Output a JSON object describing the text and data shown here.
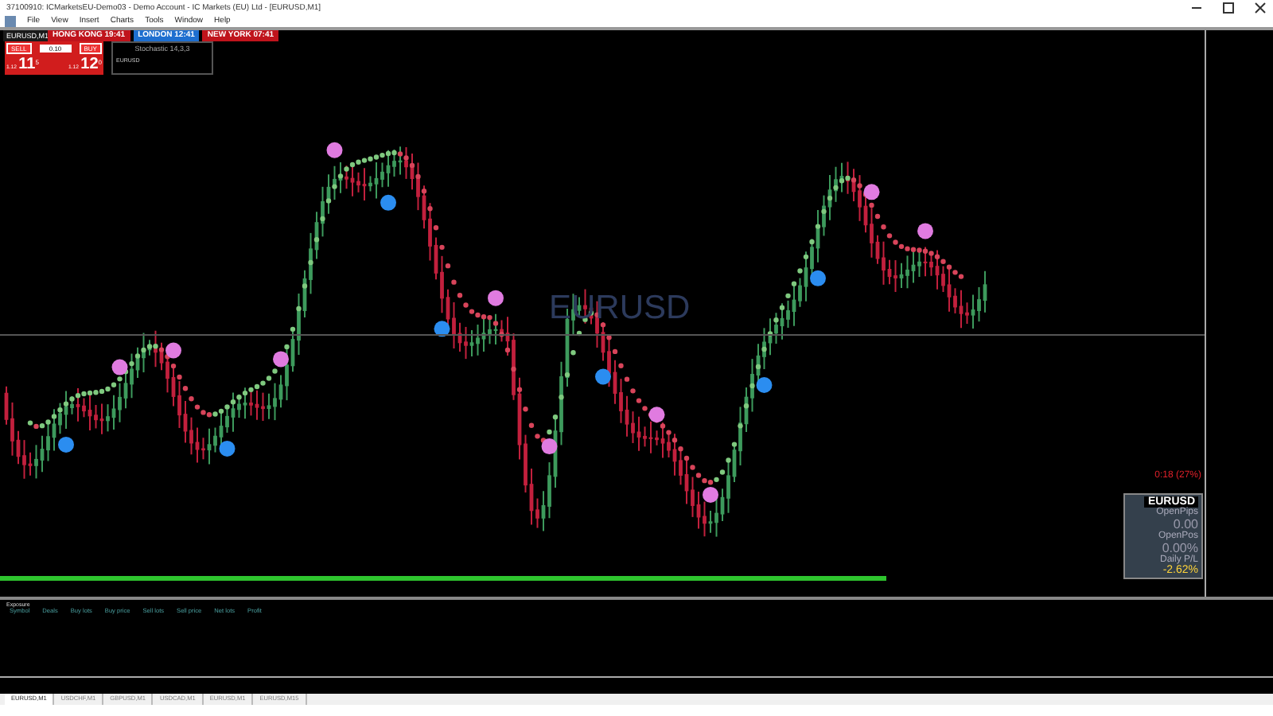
{
  "window": {
    "title": "37100910: ICMarketsEU-Demo03 - Demo Account - IC Markets (EU) Ltd - [EURUSD,M1]"
  },
  "menu": [
    "File",
    "View",
    "Insert",
    "Charts",
    "Tools",
    "Window",
    "Help"
  ],
  "chart_window": {
    "symbol": "EURUSD,M1"
  },
  "clocks": [
    {
      "city": "HONG KONG",
      "time": "19:41",
      "color": "#c0141c"
    },
    {
      "city": "LONDON",
      "time": "12:41",
      "color": "#1e6fd0"
    },
    {
      "city": "NEW YORK",
      "time": "07:41",
      "color": "#c0141c"
    }
  ],
  "trade_panel": {
    "sell_label": "SELL",
    "buy_label": "BUY",
    "lots": "0.10",
    "sell": {
      "prefix": "1.12",
      "big": "11",
      "sup": "5"
    },
    "buy": {
      "prefix": "1.12",
      "big": "12",
      "sup": "0"
    }
  },
  "stochastic": {
    "title": "Stochastic 14,3,3",
    "symbol": "EURUSD"
  },
  "watermark": "EURUSD",
  "candle_timer": "0:18 (27%)",
  "info_panel": {
    "symbol": "EURUSD",
    "rows": [
      {
        "label": "OpenPips",
        "value": "0.00",
        "kind": "plain"
      },
      {
        "label": "OpenPos",
        "value": "0.00%",
        "kind": "plain"
      },
      {
        "label": "Daily P/L",
        "value": "-2.62%",
        "kind": "highlight"
      }
    ]
  },
  "exposure": {
    "title": "Exposure",
    "columns": [
      "Symbol",
      "Deals",
      "Buy lots",
      "Buy price",
      "Sell lots",
      "Sell price",
      "Net lots",
      "Profit"
    ]
  },
  "chart_tabs": [
    {
      "label": "EURUSD,M1",
      "selected": true
    },
    {
      "label": "USDCHF,M1",
      "selected": false
    },
    {
      "label": "GBPUSD,M1",
      "selected": false
    },
    {
      "label": "USDCAD,M1",
      "selected": false
    },
    {
      "label": "EURUSD,M1",
      "selected": false
    },
    {
      "label": "EURUSD,M15",
      "selected": false
    }
  ]
}
